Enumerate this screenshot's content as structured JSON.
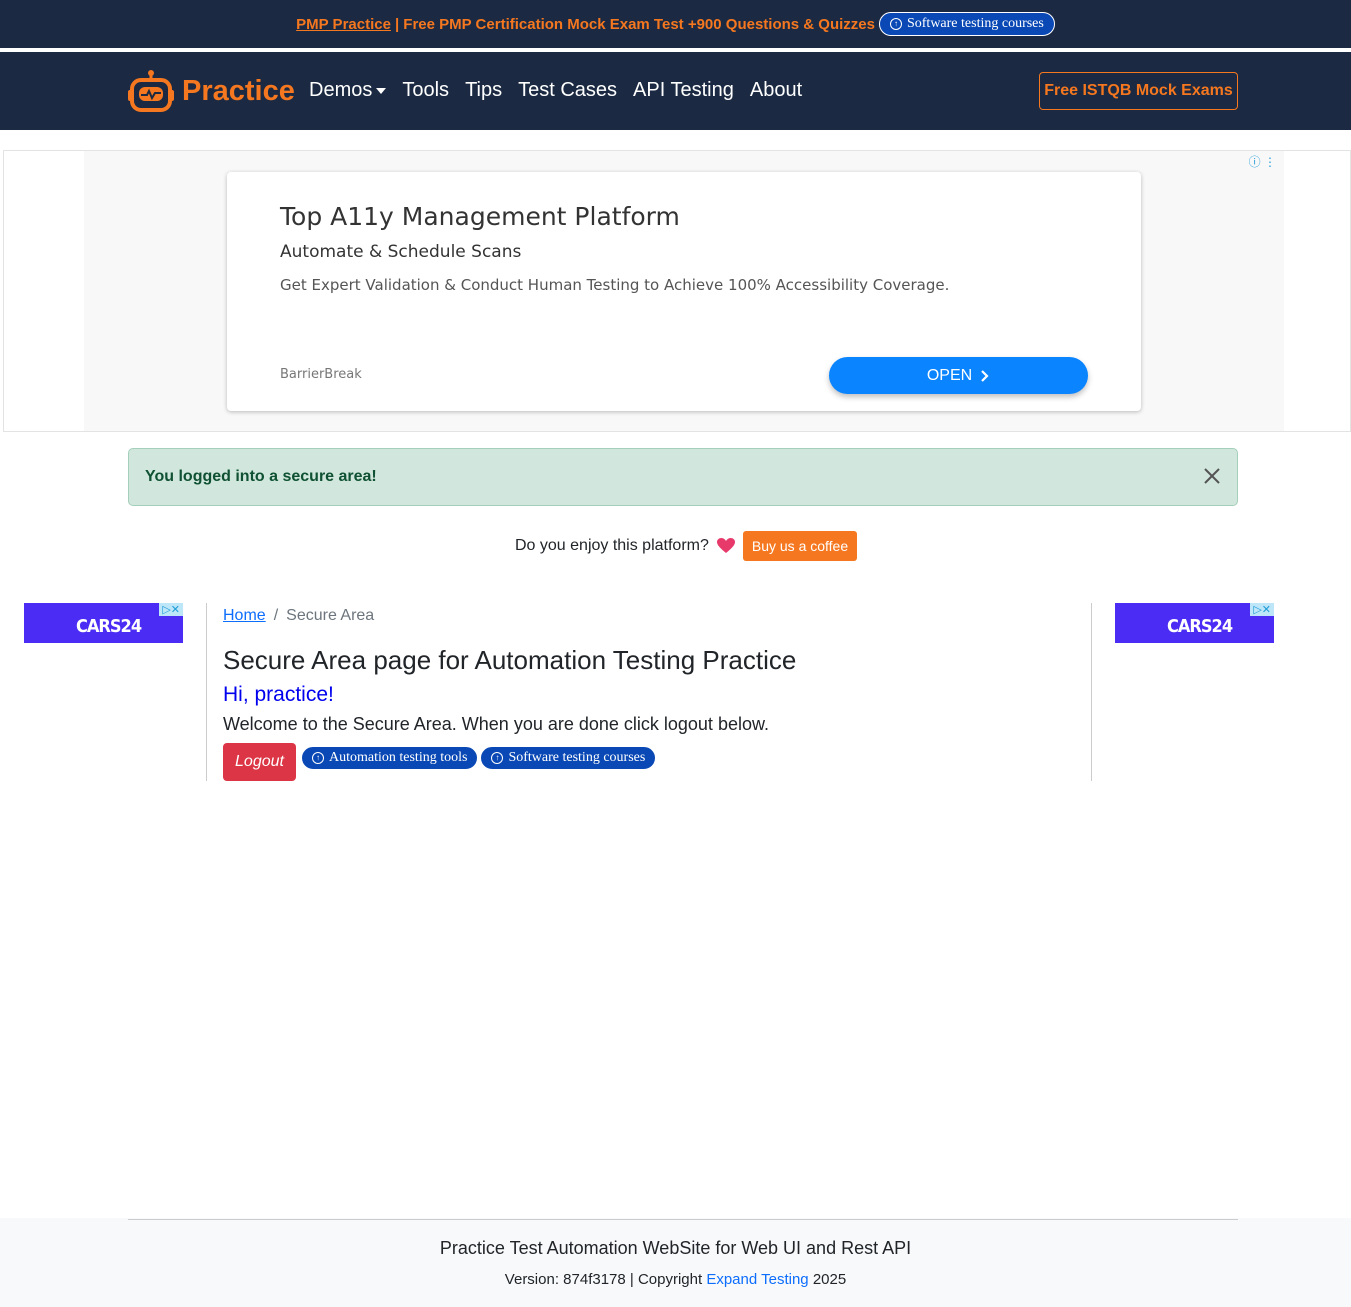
{
  "banner": {
    "pmp_link": "PMP Practice",
    "pmp_text": "| Free PMP Certification Mock Exam Test +900 Questions & Quizzes",
    "courses_pill": "Software testing courses"
  },
  "navbar": {
    "brand": "Practice",
    "links": [
      "Demos",
      "Tools",
      "Tips",
      "Test Cases",
      "API Testing",
      "About"
    ],
    "cta": "Free ISTQB Mock Exams"
  },
  "ad": {
    "title": "Top A11y Management Platform",
    "subtitle": "Automate & Schedule Scans",
    "description": "Get Expert Validation & Conduct Human Testing to Achieve 100% Accessibility Coverage.",
    "advertiser": "BarrierBreak",
    "button": "OPEN"
  },
  "alert": {
    "message": "You logged into a secure area!"
  },
  "support": {
    "question": "Do you enjoy this platform?",
    "button": "Buy us a coffee"
  },
  "side_ad": {
    "logo": "CARS24"
  },
  "main": {
    "breadcrumb": {
      "home": "Home",
      "separator": "/",
      "current": "Secure Area"
    },
    "title": "Secure Area page for Automation Testing Practice",
    "greeting": "Hi, practice!",
    "welcome": "Welcome to the Secure Area. When you are done click logout below.",
    "logout": "Logout",
    "pills": [
      "Automation testing tools",
      "Software testing courses"
    ]
  },
  "footer": {
    "title": "Practice Test Automation WebSite for Web UI and Rest API",
    "copy_prefix": "Version: 874f3178 | Copyright",
    "copy_link": "Expand Testing",
    "copy_year": "2025"
  },
  "colors": {
    "nav_bg": "#1b2a42",
    "accent_orange": "#f5771f",
    "alert_bg": "#d1e7dd",
    "logout_red": "#dc3545",
    "ad_blue": "#0a84ff"
  }
}
